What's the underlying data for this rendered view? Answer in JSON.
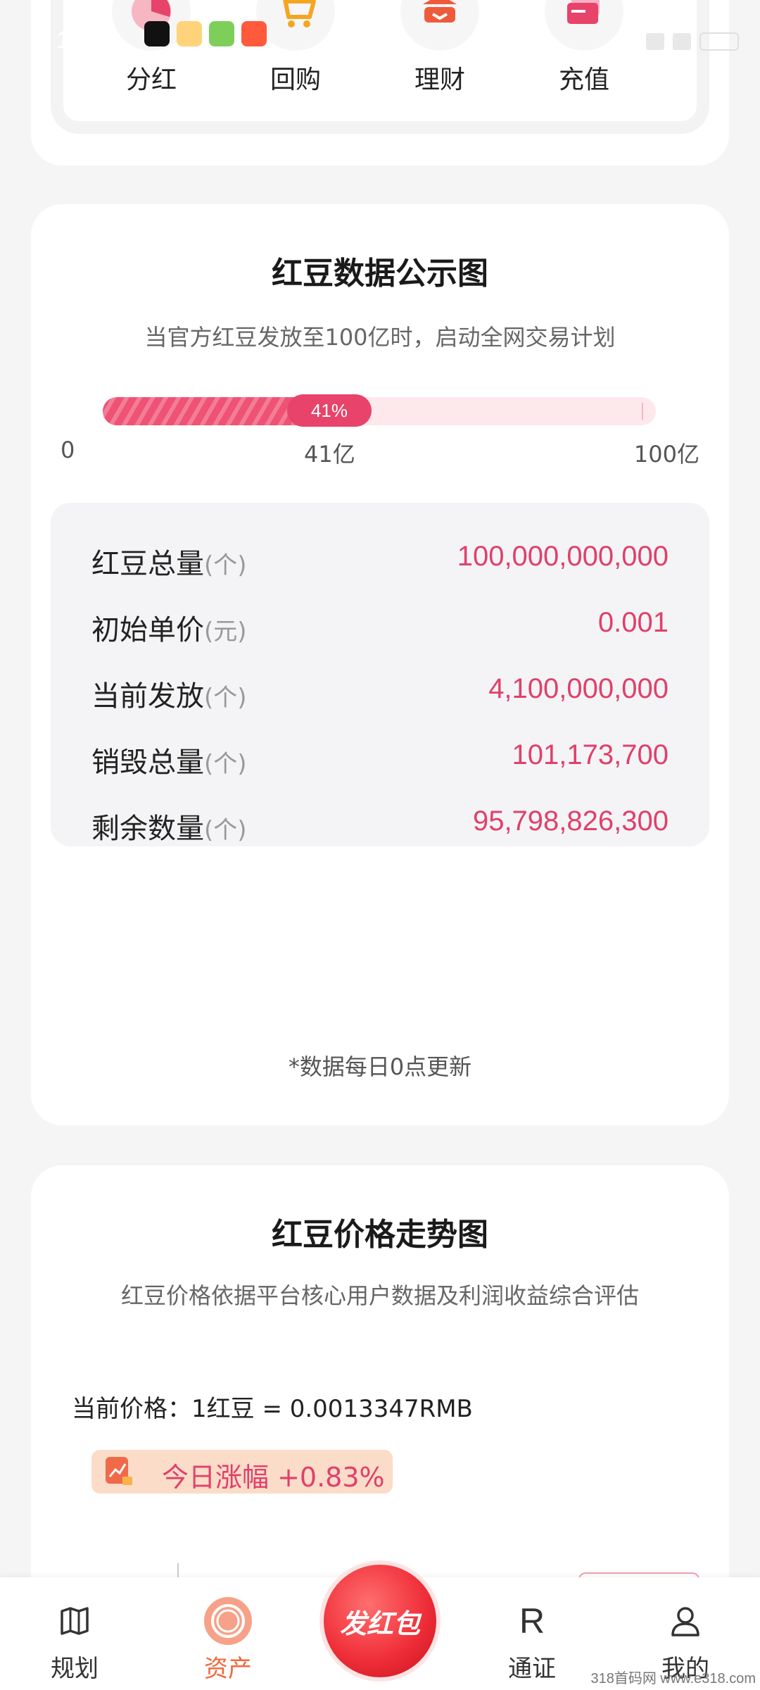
{
  "status_bar": {
    "time": "10:35"
  },
  "top_menu": {
    "items": [
      {
        "label": "分红",
        "icon": "pie-chart-icon"
      },
      {
        "label": "回购",
        "icon": "cart-icon"
      },
      {
        "label": "理财",
        "icon": "finance-icon"
      },
      {
        "label": "充值",
        "icon": "card-icon"
      }
    ]
  },
  "data_card": {
    "title": "红豆数据公示图",
    "subtitle": "当官方红豆发放至100亿时，启动全网交易计划",
    "progress": {
      "percent": 41,
      "badge": "41%",
      "start_label": "0",
      "current_label": "41亿",
      "end_label": "100亿"
    },
    "stats": [
      {
        "label": "红豆总量",
        "unit": "(个)",
        "value": "100,000,000,000"
      },
      {
        "label": "初始单价",
        "unit": "(元)",
        "value": "0.001"
      },
      {
        "label": "当前发放",
        "unit": "(个)",
        "value": "4,100,000,000"
      },
      {
        "label": "销毁总量",
        "unit": "(个)",
        "value": "101,173,700"
      },
      {
        "label": "剩余数量",
        "unit": "(个)",
        "value": "95,798,826,300"
      }
    ],
    "note": "*数据每日0点更新"
  },
  "price_card": {
    "title": "红豆价格走势图",
    "subtitle": "红豆价格依据平台核心用户数据及利润收益综合评估",
    "current_price": "当前价格：1红豆  = 0.0013347RMB",
    "daily_change": "今日涨幅 +0.83%"
  },
  "bottom_nav": {
    "items": [
      {
        "label": "规划",
        "icon": "map-icon",
        "active": false
      },
      {
        "label": "资产",
        "icon": "coin-icon",
        "active": true
      },
      {
        "label": "通证",
        "icon": "r-letter-icon",
        "active": false
      },
      {
        "label": "我的",
        "icon": "person-icon",
        "active": false
      }
    ],
    "center_button": "发红包"
  },
  "watermark": "318首码网 www.e318.com",
  "colors": {
    "accent": "#e0406a",
    "active_tab": "#f0683e",
    "background": "#f5f5f5"
  }
}
